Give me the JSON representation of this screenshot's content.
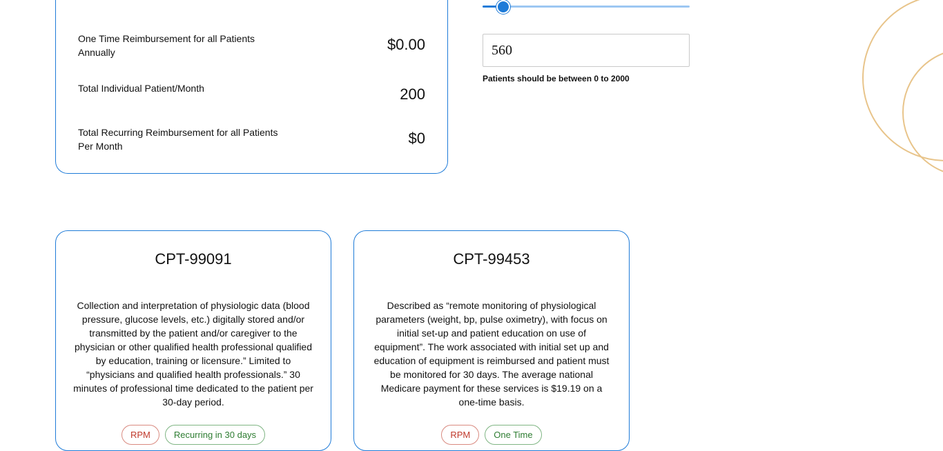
{
  "summary": {
    "rows": [
      {
        "label": "One Time Reimbursement for all Patients Annually",
        "value": "$0.00"
      },
      {
        "label": "Total Individual Patient/Month",
        "value": "200"
      },
      {
        "label": "Total Recurring Reimbursement for all Patients Per Month",
        "value": "$0"
      }
    ]
  },
  "patients": {
    "input_value": "560",
    "hint": "Patients should be between 0 to 2000",
    "slider_fraction": 0.1
  },
  "cards": [
    {
      "title": "CPT-99091",
      "description": "Collection and interpretation of physiologic data (blood pressure, glucose levels, etc.) digitally stored and/or transmitted by the patient and/or caregiver to the physician or other qualified health professional qualified by education, training or licensure.” Limited to “physicians and qualified health professionals.” 30 minutes of professional time dedicated to the patient per 30-day period.",
      "tags": [
        "RPM",
        "Recurring in 30 days"
      ]
    },
    {
      "title": "CPT-99453",
      "description": "Described as “remote monitoring of physiological parameters (weight, bp, pulse oximetry), with focus on initial set-up and patient education on use of equipment”. The work associated with initial set up and education of equipment is reimbursed and patient must be monitored for 30 days. The average national Medicare payment for these services is $19.19 on a one-time basis.",
      "tags": [
        "RPM",
        "One Time"
      ]
    }
  ],
  "colors": {
    "accent": "#1e7bd8",
    "decoration": "#e8c48a"
  }
}
